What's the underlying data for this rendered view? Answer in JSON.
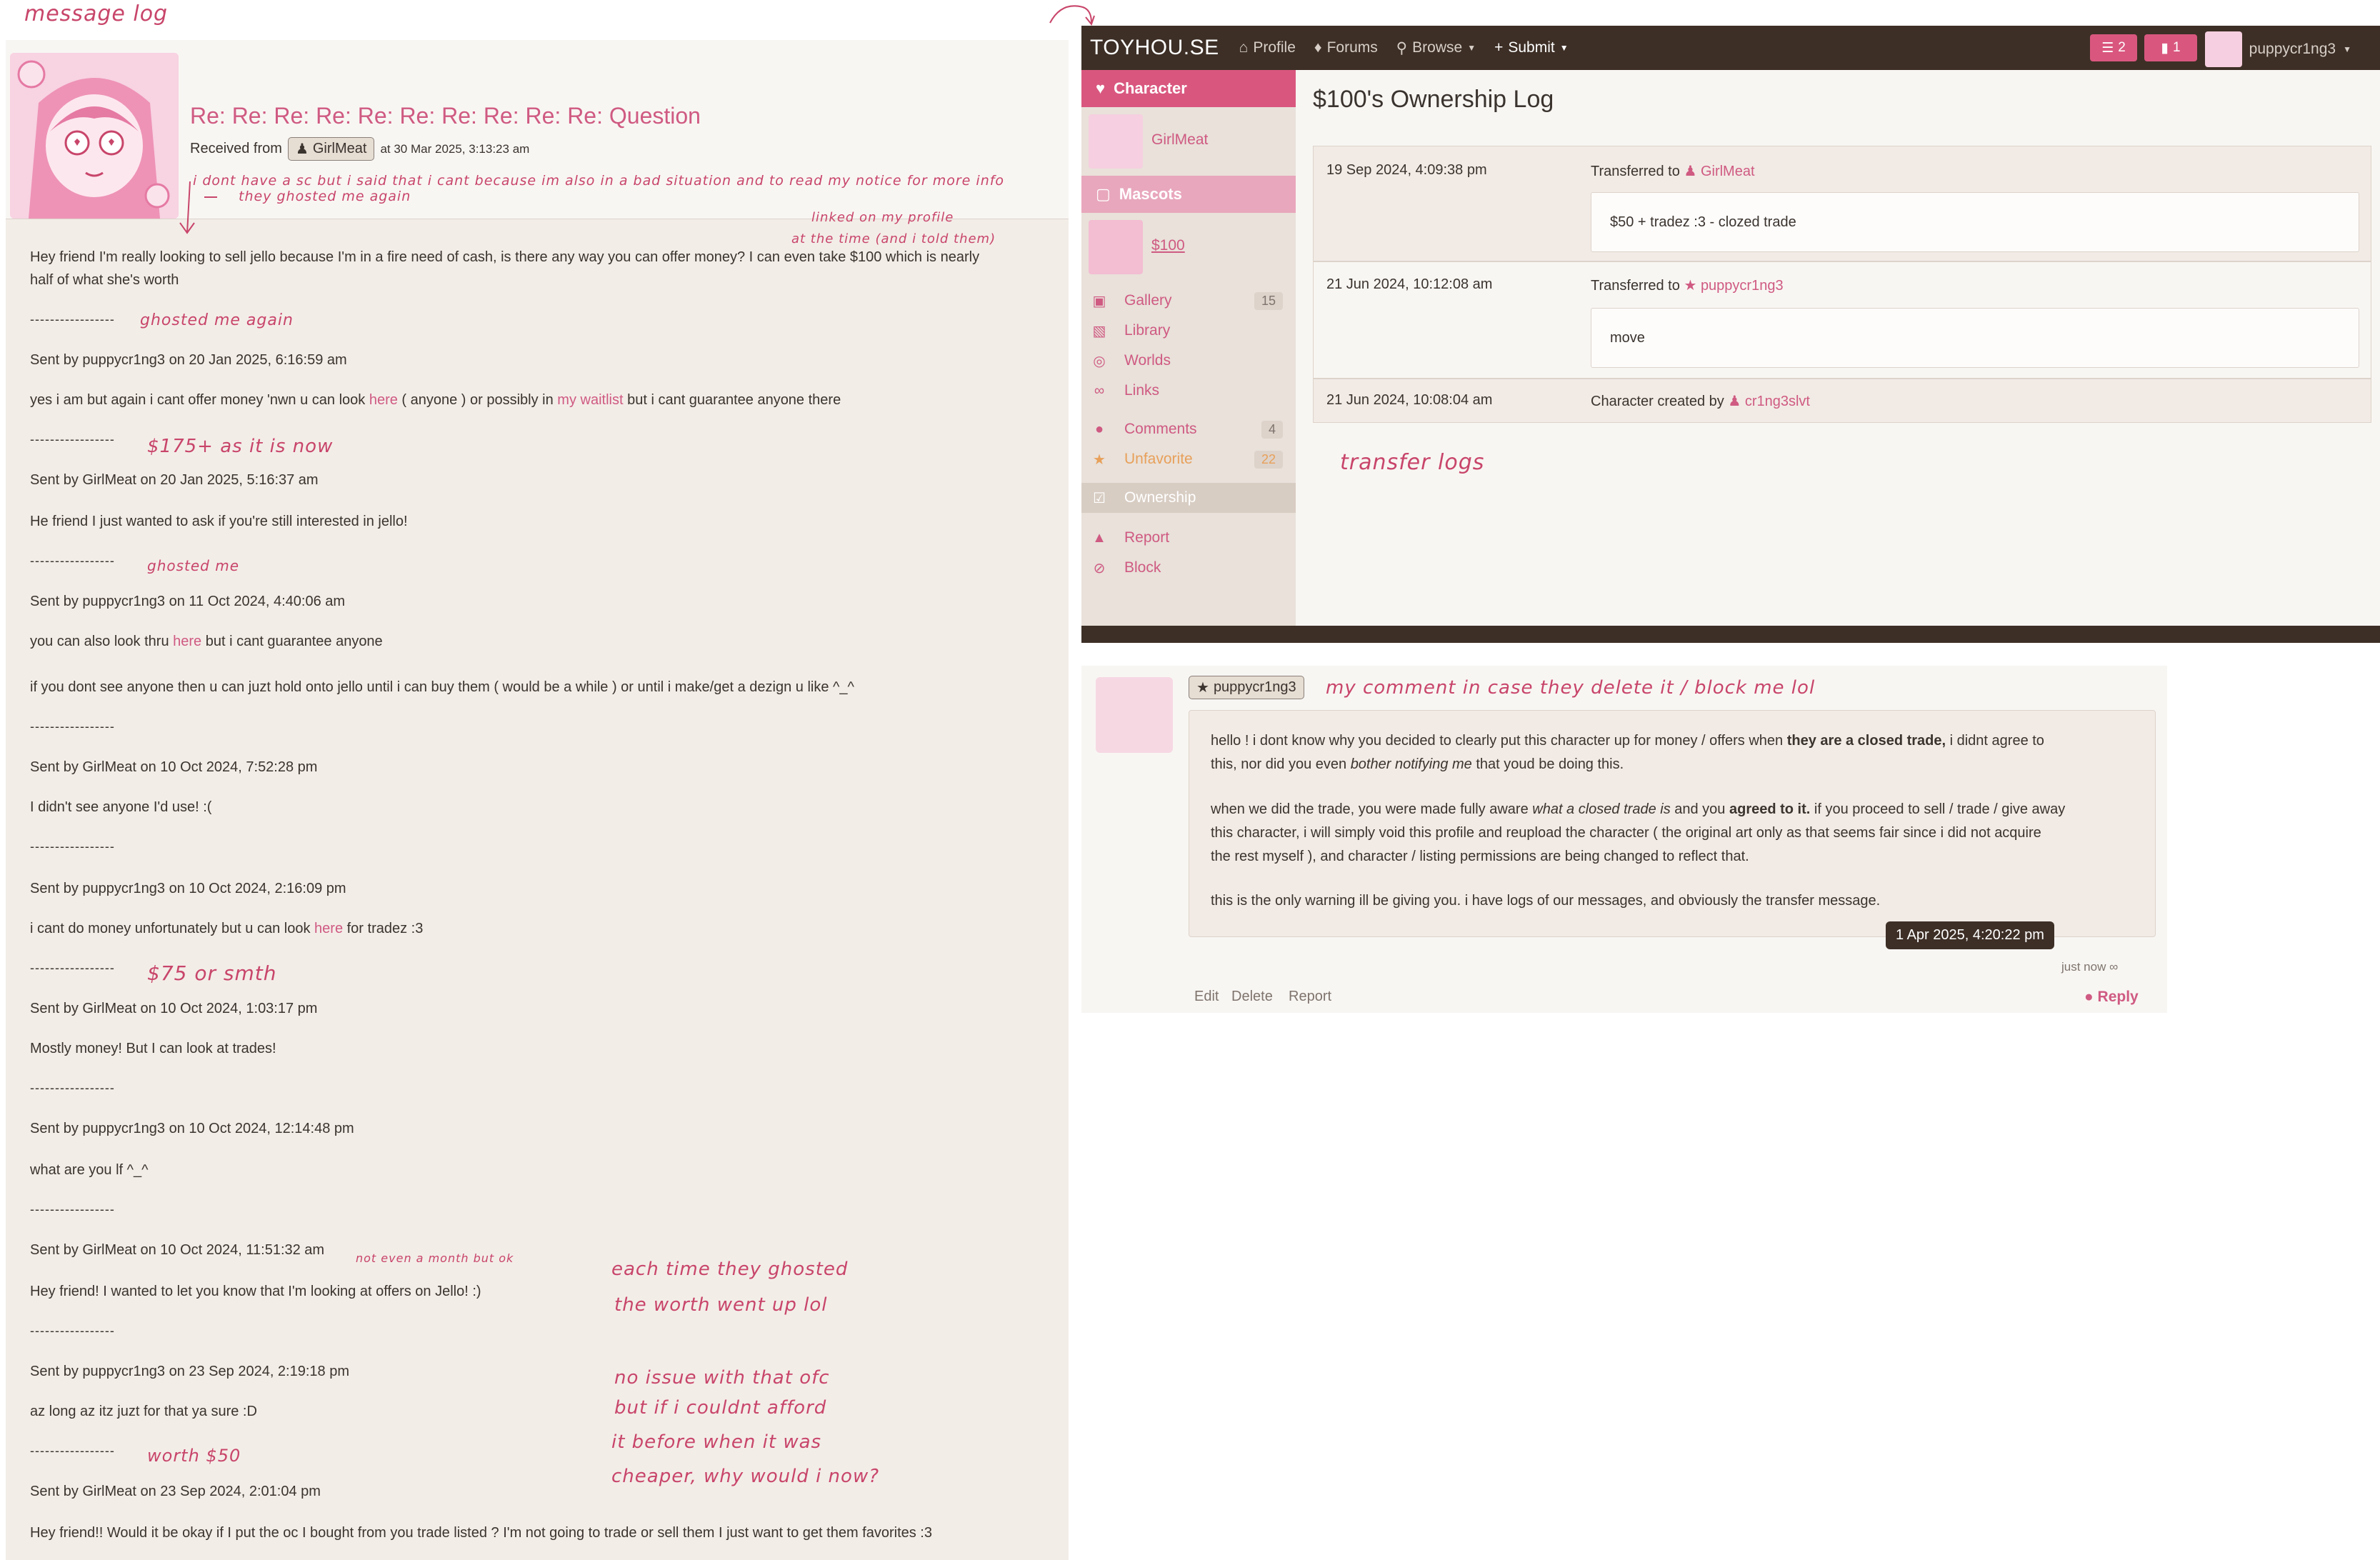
{
  "annotations": {
    "message_log": "message log",
    "dont_have_sc": "i dont have a sc but i said that i cant because im also in a bad situation and to read my notice for more info",
    "they_ghosted": "they ghosted me again",
    "linked_profile": "linked on my profile",
    "at_the_time": "at the time (and i told them)",
    "ghosted_me_again": "ghosted me again",
    "price_175": "$175+ as it is now",
    "ghosted_me": "ghosted me",
    "price_75": "$75 or smth",
    "not_a_month": "not even a month but ok",
    "each_time_1": "each time they ghosted",
    "each_time_2": "the worth went up lol",
    "no_issue_1": "no issue with that ofc",
    "no_issue_2": "but if i couldnt afford",
    "no_issue_3": "it before when it was",
    "no_issue_4": "cheaper, why would i now?",
    "worth_50": "worth $50",
    "transfer_logs": "transfer logs",
    "my_comment": "my comment in case they delete it / block me lol"
  },
  "message": {
    "title": "Re: Re: Re: Re: Re: Re: Re: Re: Re: Re: Question",
    "received_from": "Received from",
    "sender": "GirlMeat",
    "timestamp": "at 30 Mar 2025, 3:13:23 am",
    "lines": {
      "l1a": "Hey friend I'm really looking to sell jello because I'm in a fire need of cash, is there any way you can offer money? I can even take $100 which is nearly",
      "l1b": "half of what she's worth",
      "dash": "-----------------",
      "s1": "Sent by puppycr1ng3 on 20 Jan 2025, 6:16:59 am",
      "b1_pre": "yes i am but again i cant offer money 'nwn u can look ",
      "b1_link1": "here",
      "b1_mid": " ( anyone ) or possibly in ",
      "b1_link2": "my waitlist",
      "b1_post": " but i cant guarantee anyone there",
      "s2": "Sent by GirlMeat on 20 Jan 2025, 5:16:37 am",
      "b2": "He friend I just wanted to ask if you're still interested in jello!",
      "s3": "Sent by puppycr1ng3 on 11 Oct 2024, 4:40:06 am",
      "b3_pre": "you can also look thru ",
      "b3_link": "here",
      "b3_post": " but i cant guarantee anyone",
      "b3b": "if you dont see anyone then u can juzt hold onto jello until i can buy them ( would be a while ) or until i make/get a dezign u like ^_^",
      "s4": "Sent by GirlMeat on 10 Oct 2024, 7:52:28 pm",
      "b4": "I didn't see anyone I'd use! :(",
      "s5": "Sent by puppycr1ng3 on 10 Oct 2024, 2:16:09 pm",
      "b5_pre": "i cant do money unfortunately but u can look ",
      "b5_link": "here",
      "b5_post": " for tradez :3",
      "s6": "Sent by GirlMeat on 10 Oct 2024, 1:03:17 pm",
      "b6": "Mostly money! But I can look at trades!",
      "s7": "Sent by puppycr1ng3 on 10 Oct 2024, 12:14:48 pm",
      "b7": "what are you lf ^_^",
      "s8": "Sent by GirlMeat on 10 Oct 2024, 11:51:32 am",
      "b8": "Hey friend! I wanted to let you know that I'm looking at offers on Jello! :)",
      "s9": "Sent by puppycr1ng3 on 23 Sep 2024, 2:19:18 pm",
      "b9": "az long az itz juzt for that ya sure :D",
      "s10": "Sent by GirlMeat on 23 Sep 2024, 2:01:04 pm",
      "b10": "Hey friend!! Would it be okay if I put the oc I bought from you trade listed ? I'm not going to trade or sell them I just want to get them favorites :3"
    }
  },
  "toyhouse": {
    "brand": "TOYHOU.SE",
    "nav": {
      "profile": "Profile",
      "forums": "Forums",
      "browse": "Browse",
      "submit": "Submit"
    },
    "notif_count": "2",
    "msg_count": "1",
    "username": "puppycr1ng3",
    "sidebar": {
      "character": "Character",
      "char_name": "GirlMeat",
      "mascots": "Mascots",
      "mascot_name": "$100",
      "gallery": "Gallery",
      "gallery_count": "15",
      "library": "Library",
      "worlds": "Worlds",
      "links": "Links",
      "comments": "Comments",
      "comments_count": "4",
      "unfavorite": "Unfavorite",
      "unfavorite_count": "22",
      "ownership": "Ownership",
      "report": "Report",
      "block": "Block"
    },
    "ownership_title": "$100's Ownership Log",
    "log": {
      "r1_date": "19 Sep 2024, 4:09:38 pm",
      "r1_text": "Transferred to",
      "r1_user": "GirlMeat",
      "r1_note": "$50 + tradez :3 - clozed trade",
      "r2_date": "21 Jun 2024, 10:12:08 am",
      "r2_text": "Transferred to",
      "r2_user": "puppycr1ng3",
      "r2_note": "move",
      "r3_date": "21 Jun 2024, 10:08:04 am",
      "r3_text": "Character created by",
      "r3_user": "cr1ng3slvt"
    }
  },
  "comment": {
    "user": "puppycr1ng3",
    "p1_a": "hello ! i dont know why you decided to clearly put this character up for money / offers when ",
    "p1_b": "they are a closed trade,",
    "p1_c": " i didnt agree to",
    "p1_d": "this, nor did you even ",
    "p1_e": "bother notifying me",
    "p1_f": " that youd be doing this.",
    "p2_a": "when we did the trade, you were made fully aware ",
    "p2_b": "what a closed trade is",
    "p2_c": " and you ",
    "p2_d": "agreed to it.",
    "p2_e": " if you proceed to sell / trade / give away",
    "p2_l2": "this character, i will simply void this profile and reupload the character ( the original art only as that seems fair since i did not acquire",
    "p2_l3": "the rest myself ), and character / listing permissions are being changed to reflect that.",
    "p3": "this is the only warning ill be giving you. i have logs of our messages, and obviously the transfer message.",
    "tooltip": "1 Apr 2025, 4:20:22 pm",
    "justnow": "just now",
    "edit": "Edit",
    "delete": "Delete",
    "report": "Report",
    "reply": "Reply"
  }
}
